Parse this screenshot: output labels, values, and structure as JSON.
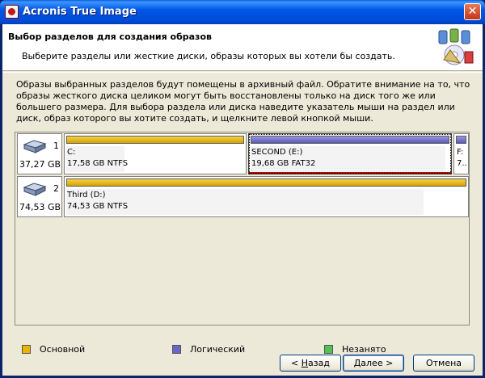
{
  "window": {
    "title": "Acronis True Image",
    "close_glyph": "✕"
  },
  "header": {
    "title": "Выбор разделов для создания образов",
    "subtitle": "Выберите разделы или жесткие диски, образы которых вы хотели бы создать.",
    "art_icon": "disk-image-wizard-icon"
  },
  "description": "Образы выбранных разделов будут помещены в архивный файл. Обратите внимание на то, что образы жесткого диска целиком могут быть восстановлены только на диск того же или большего размера. Для выбора раздела или диска наведите указатель мыши на раздел или диск, образ которого вы хотите создать, и щелкните левой кнопкой мыши.",
  "disks": [
    {
      "number": "1",
      "size": "37,27 GB",
      "partitions": [
        {
          "name": "C:",
          "meta": "17,58 GB  NTFS",
          "type": "primary",
          "selected": false,
          "used_fraction": 0.33
        },
        {
          "name": "SECOND (E:)",
          "meta": "19,68 GB  FAT32",
          "type": "logical",
          "selected": true,
          "used_fraction": 0.97
        },
        {
          "name": "F:",
          "meta": "7..",
          "type": "logical",
          "selected": false,
          "used_fraction": 0.5
        }
      ]
    },
    {
      "number": "2",
      "size": "74,53 GB",
      "partitions": [
        {
          "name": "Third (D:)",
          "meta": "74,53 GB  NTFS",
          "type": "primary",
          "selected": false,
          "used_fraction": 0.88
        }
      ]
    }
  ],
  "legend": [
    {
      "label": "Основной",
      "color": "#e8b400"
    },
    {
      "label": "Логический",
      "color": "#6a66c8"
    },
    {
      "label": "Незанято",
      "color": "#4fc24f"
    }
  ],
  "buttons": {
    "back": {
      "prefix": "< ",
      "hotkey": "Н",
      "rest": "азад"
    },
    "next": {
      "hotkey": "Д",
      "rest": "алее >"
    },
    "cancel": "Отмена"
  },
  "colors": {
    "primary": "#e8b400",
    "logical": "#6a66c8",
    "unallocated": "#4fc24f",
    "titlebar": "#0058e6",
    "selection": "#d40000"
  }
}
